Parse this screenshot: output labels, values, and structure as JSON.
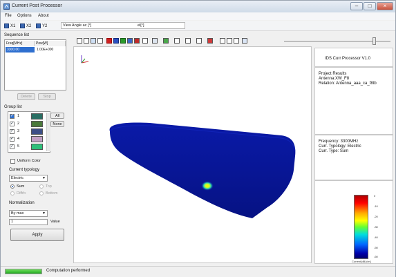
{
  "window": {
    "title": "Current Post Processor",
    "buttons": [
      "–",
      "□",
      "×"
    ]
  },
  "menu": {
    "items": [
      "File",
      "Options",
      "About"
    ]
  },
  "toolbar": {
    "view_x": "X1",
    "view_x2": "X2",
    "view_y": "Y2",
    "view_angle_label": "View Angle ac [°]",
    "view_angle_right": "el[°]"
  },
  "sequence": {
    "label": "Sequence list",
    "headers": [
      "Freq[MHz]",
      "Pow[W]"
    ],
    "rows": [
      [
        "3300.00",
        "1.00E+000"
      ]
    ],
    "buttons": [
      "Delete",
      "Stop"
    ]
  },
  "groups": {
    "label": "Group list",
    "rows": [
      {
        "num": "1",
        "color": "#2a6e63",
        "checked": true
      },
      {
        "num": "2",
        "color": "#4a7a3a",
        "checked": true
      },
      {
        "num": "3",
        "color": "#3d4e86",
        "checked": true
      },
      {
        "num": "4",
        "color": "#c2a0c4",
        "checked": true
      },
      {
        "num": "5",
        "color": "#2fbf7a",
        "checked": true
      }
    ],
    "all_label": "All",
    "none_label": "None",
    "uniform_color_label": "Uniform Color"
  },
  "current_typology": {
    "label": "Current typology",
    "selected": "Electric",
    "radios": [
      {
        "label": "Sum",
        "on": true,
        "enabled": true
      },
      {
        "label": "Top",
        "on": false,
        "enabled": false
      },
      {
        "label": "Diffrb",
        "on": false,
        "enabled": false
      },
      {
        "label": "Bottom",
        "on": false,
        "enabled": false
      }
    ]
  },
  "normalization": {
    "label": "Normalization",
    "selected": "By max",
    "value": "1",
    "value_label": "Value"
  },
  "apply_label": "Apply",
  "info": {
    "version": "IDS Curr Processor V1.0",
    "project": [
      "Project Results",
      "Antenna:XW_F8",
      "Relation: Antenna_aaa_ca_f8tb"
    ],
    "params": [
      "Frequency: 3300MHz",
      "Curr. Typology: Electric",
      "Curr. Type: Sum"
    ]
  },
  "colorbar": {
    "ticks": [
      "0",
      "-10",
      "-20",
      "-30",
      "-40",
      "-50",
      "-60"
    ],
    "unit": "Current[dBA/m]"
  },
  "status": {
    "text": "Computation performed",
    "progress": 1.0
  },
  "colors": {
    "mesh": "#08169e",
    "hotspot": "#ffe000"
  }
}
